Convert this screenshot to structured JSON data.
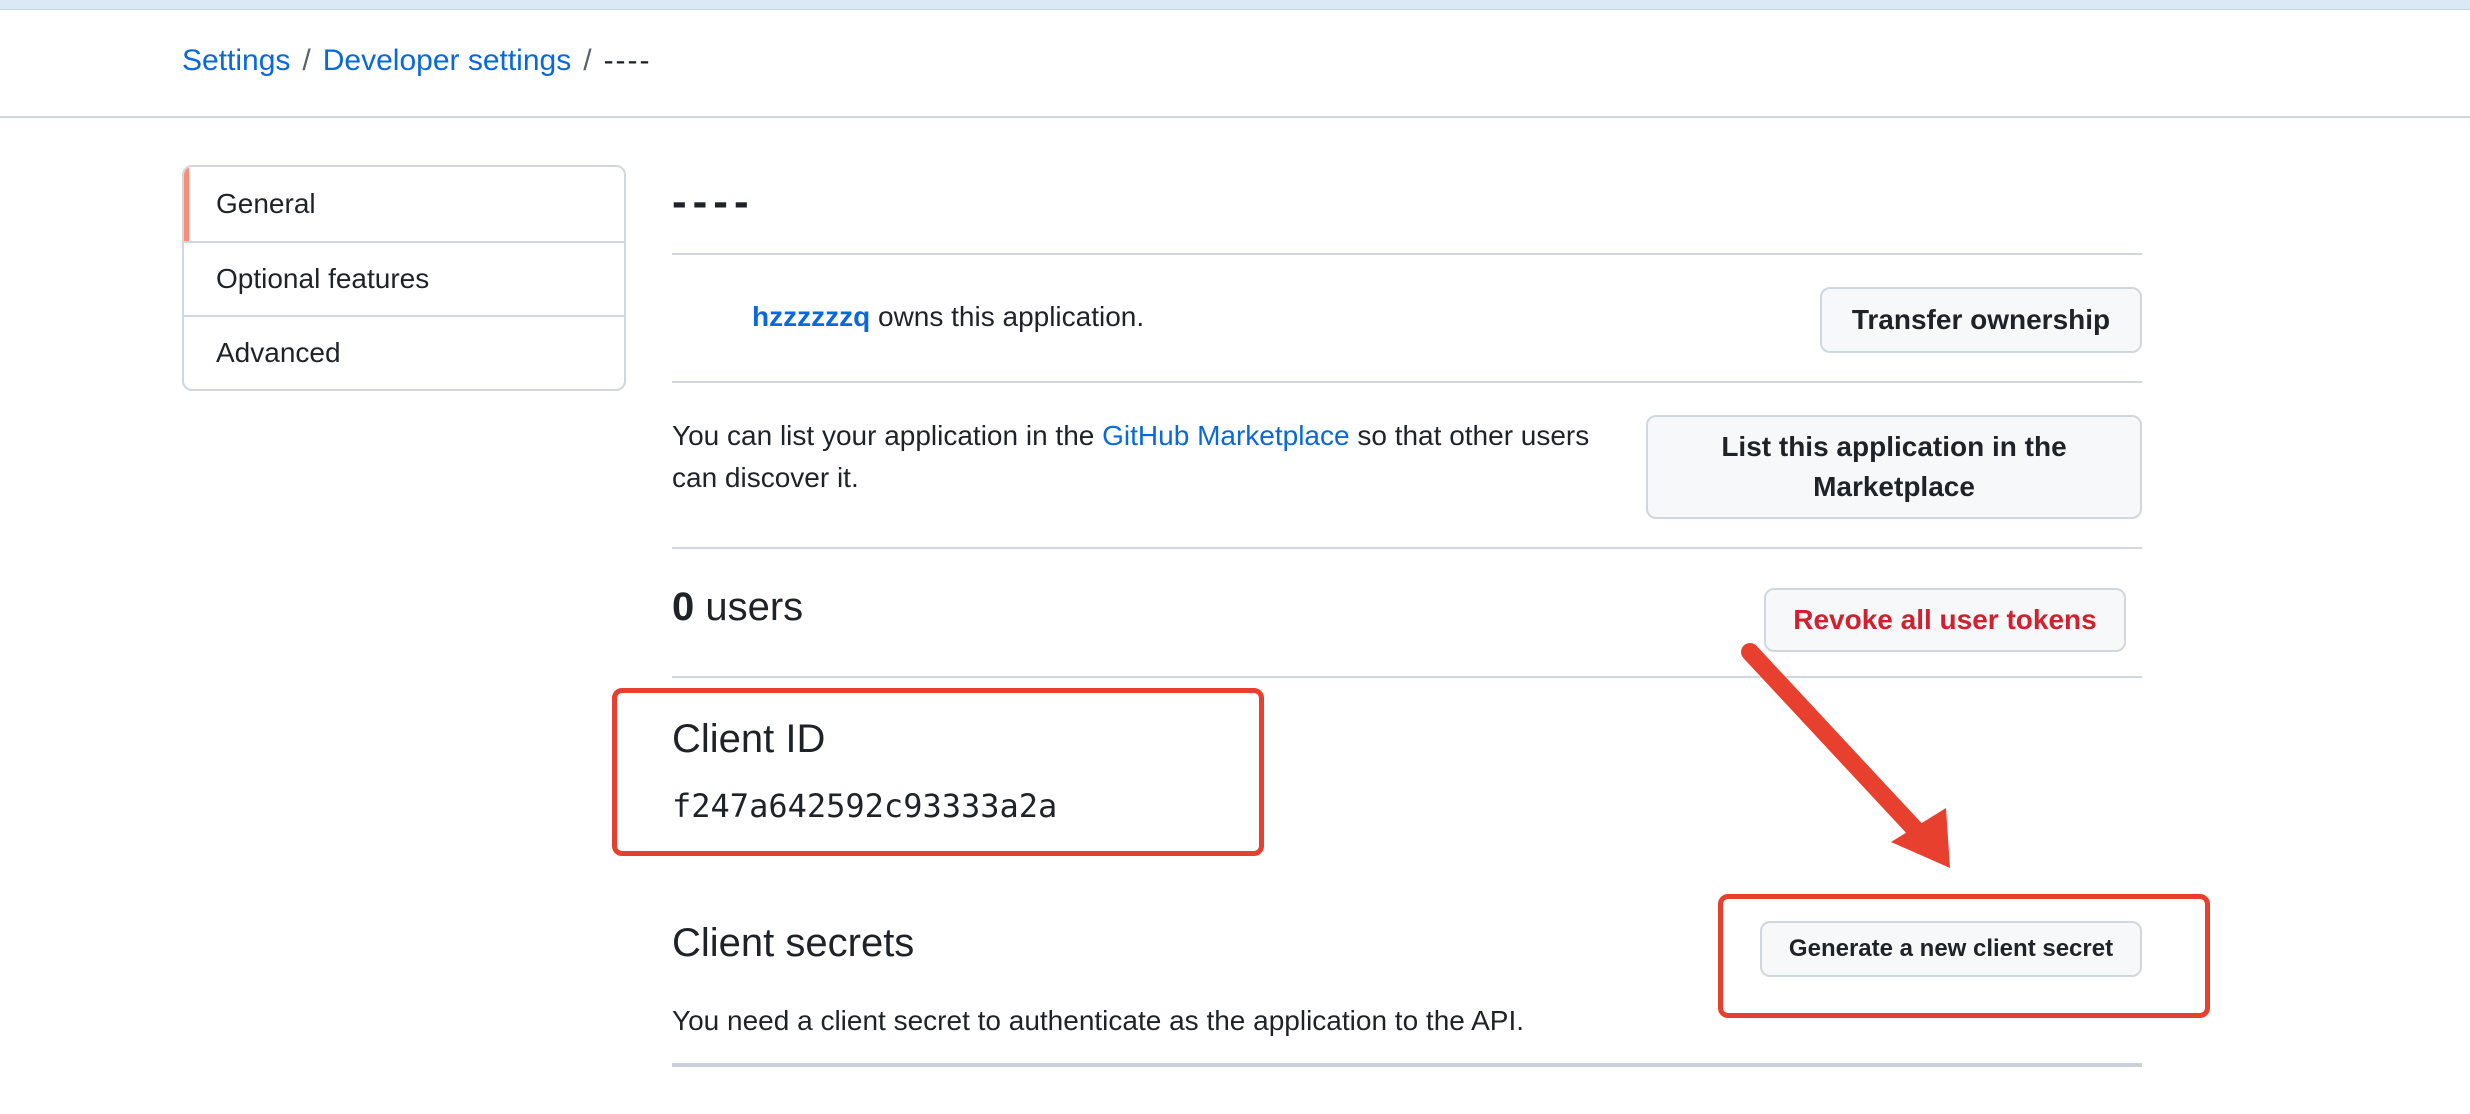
{
  "breadcrumb": {
    "settings": "Settings",
    "developer_settings": "Developer settings",
    "current": "----",
    "separator": "/"
  },
  "sidebar": {
    "items": [
      {
        "label": "General",
        "active": true
      },
      {
        "label": "Optional features",
        "active": false
      },
      {
        "label": "Advanced",
        "active": false
      }
    ]
  },
  "app": {
    "title": "----",
    "owner": "hzzzzzzq",
    "owner_suffix": " owns this application.",
    "transfer_button": "Transfer ownership",
    "marketplace_text_before": "You can list your application in the ",
    "marketplace_link": "GitHub Marketplace",
    "marketplace_text_after": " so that other users can discover it.",
    "marketplace_button": "List this application in the Marketplace",
    "users_count": "0",
    "users_label": " users",
    "revoke_button": "Revoke all user tokens",
    "client_id_label": "Client ID",
    "client_id_value": "f247a642592c93333a2a",
    "client_secrets_label": "Client secrets",
    "generate_secret_button": "Generate a new client secret",
    "client_secret_desc": "You need a client secret to authenticate as the application to the API."
  },
  "colors": {
    "link": "#0969da",
    "danger": "#cf222e",
    "annotation": "#e8402f",
    "active_indicator": "#fd8c73"
  }
}
